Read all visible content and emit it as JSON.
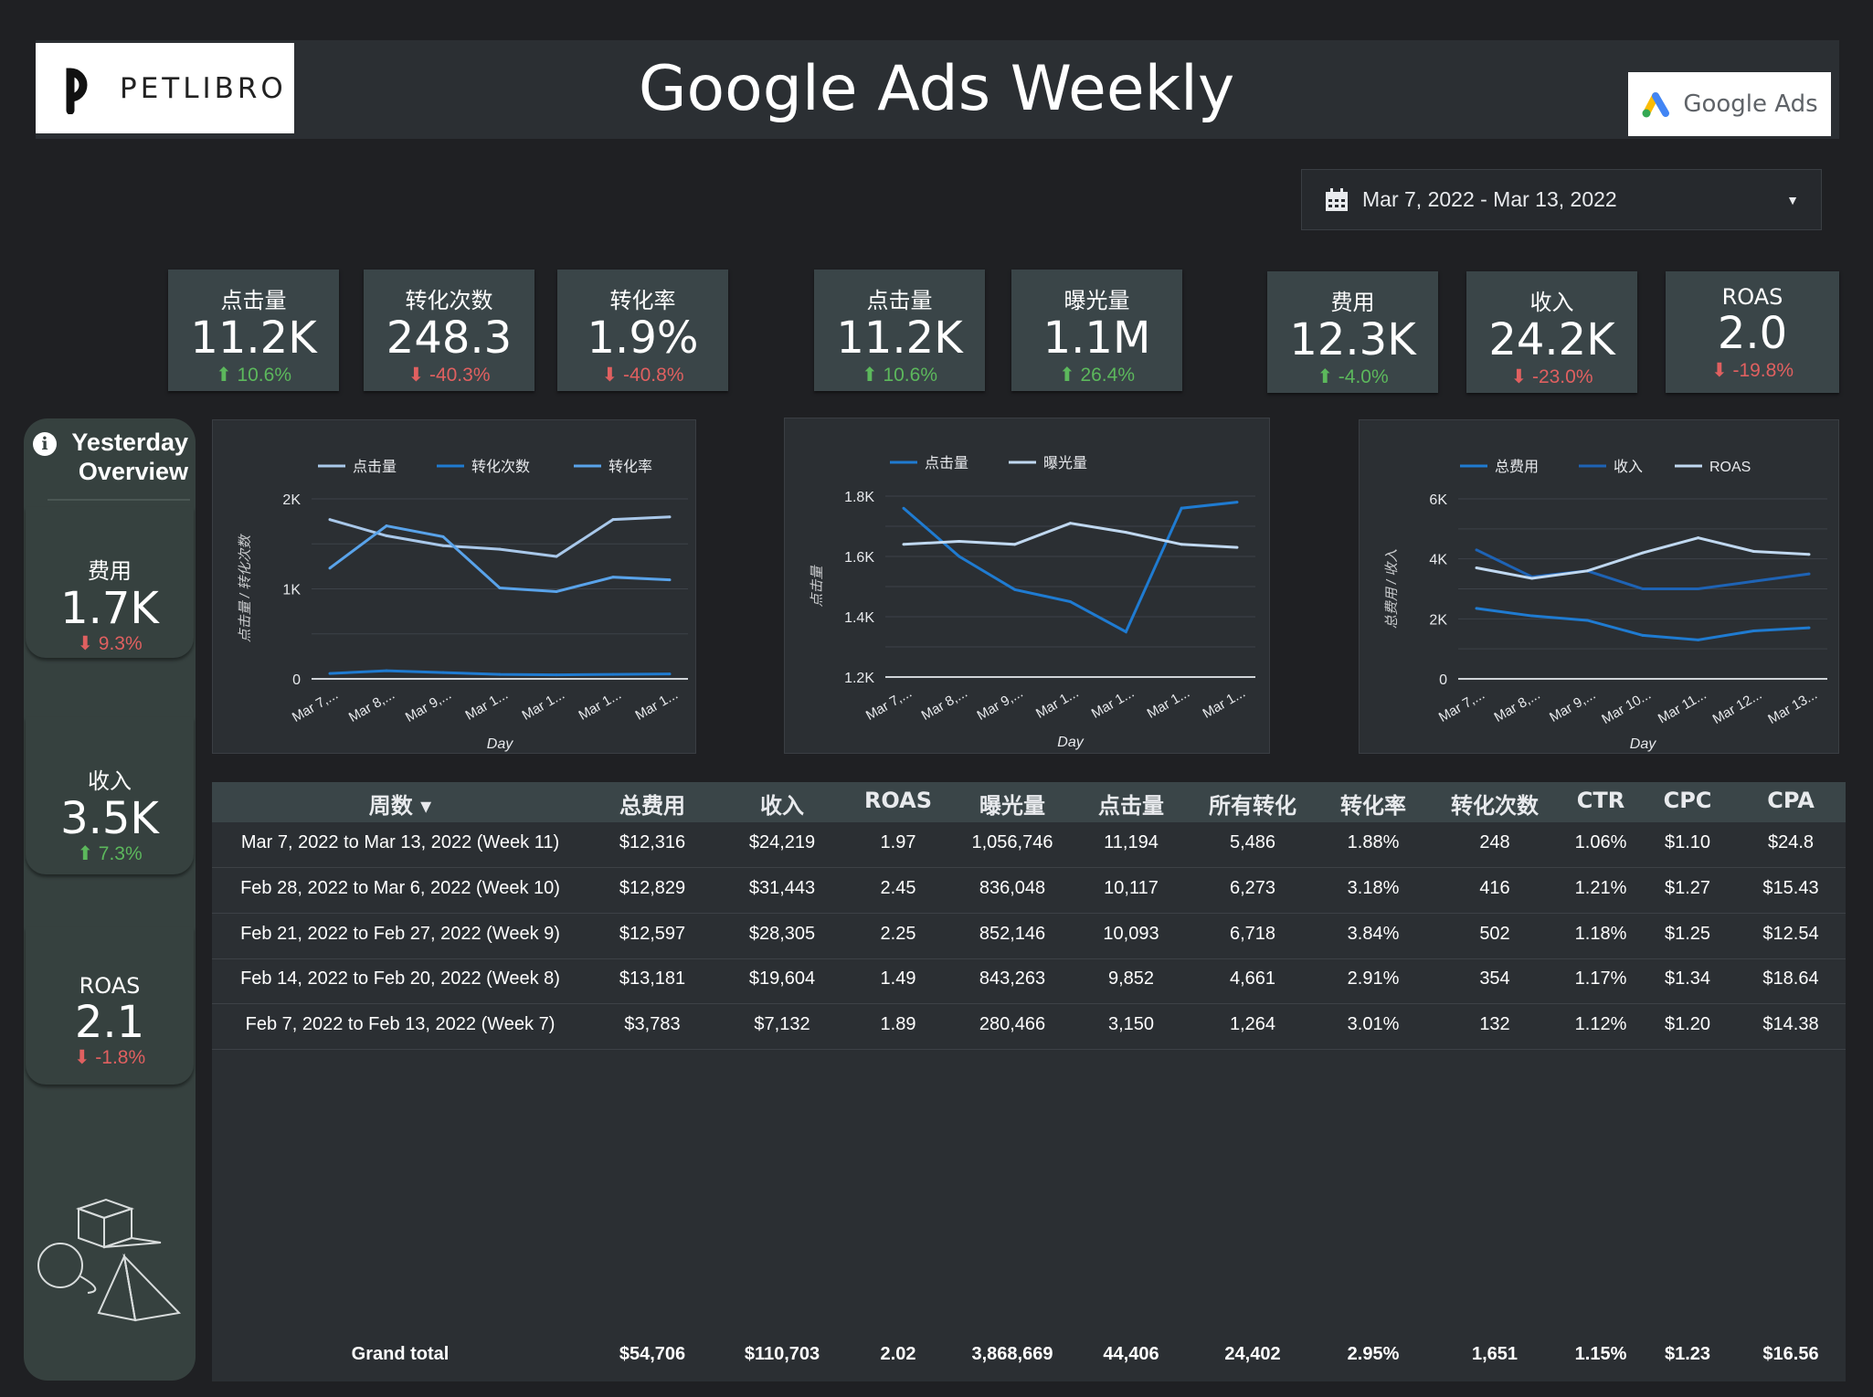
{
  "header": {
    "brand": "PETLIBRO",
    "title": "Google Ads Weekly",
    "gads_label": "Google Ads"
  },
  "date_range": "Mar 7, 2022 - Mar 13, 2022",
  "kpis": [
    {
      "label": "点击量",
      "value": "11.2K",
      "change": "10.6%",
      "dir": "up"
    },
    {
      "label": "转化次数",
      "value": "248.3",
      "change": "-40.3%",
      "dir": "down"
    },
    {
      "label": "转化率",
      "value": "1.9%",
      "change": "-40.8%",
      "dir": "down"
    },
    {
      "label": "点击量",
      "value": "11.2K",
      "change": "10.6%",
      "dir": "up"
    },
    {
      "label": "曝光量",
      "value": "1.1M",
      "change": "26.4%",
      "dir": "up"
    },
    {
      "label": "费用",
      "value": "12.3K",
      "change": "-4.0%",
      "dir": "up"
    },
    {
      "label": "收入",
      "value": "24.2K",
      "change": "-23.0%",
      "dir": "down"
    },
    {
      "label": "ROAS",
      "value": "2.0",
      "change": "-19.8%",
      "dir": "down"
    }
  ],
  "sidebar": {
    "title_line1": "Yesterday",
    "title_line2": "Overview",
    "cards": [
      {
        "label": "费用",
        "value": "1.7K",
        "change": "9.3%",
        "dir": "down"
      },
      {
        "label": "收入",
        "value": "3.5K",
        "change": "7.3%",
        "dir": "up"
      },
      {
        "label": "ROAS",
        "value": "2.1",
        "change": "-1.8%",
        "dir": "down"
      }
    ]
  },
  "chart_data": [
    {
      "type": "line",
      "x": [
        "Mar 7,...",
        "Mar 8,...",
        "Mar 9,...",
        "Mar 1...",
        "Mar 1...",
        "Mar 1...",
        "Mar 1..."
      ],
      "xlabel": "Day",
      "ylabel": "点击量 / 转化次数",
      "ylim": [
        0,
        2000
      ],
      "yticks": [
        "0",
        "1K",
        "2K"
      ],
      "grid": true,
      "legend_position": "top",
      "series": [
        {
          "name": "点击量",
          "color": "#a9c8ea",
          "values": [
            1770,
            1590,
            1480,
            1440,
            1360,
            1770,
            1800
          ]
        },
        {
          "name": "转化次数",
          "color": "#1f7bd1",
          "values": [
            60,
            90,
            70,
            50,
            45,
            50,
            55
          ]
        },
        {
          "name": "转化率",
          "color": "#59a3ea",
          "values": [
            1230,
            1700,
            1580,
            1010,
            970,
            1130,
            1100
          ]
        }
      ]
    },
    {
      "type": "line",
      "x": [
        "Mar 7,...",
        "Mar 8,...",
        "Mar 9,...",
        "Mar 1...",
        "Mar 1...",
        "Mar 1...",
        "Mar 1..."
      ],
      "xlabel": "Day",
      "ylabel": "点击量",
      "ylim": [
        1200,
        1800
      ],
      "yticks": [
        "1.2K",
        "1.4K",
        "1.6K",
        "1.8K"
      ],
      "grid": true,
      "legend_position": "top",
      "series": [
        {
          "name": "点击量",
          "color": "#1f7bd1",
          "values": [
            1760,
            1600,
            1490,
            1450,
            1350,
            1760,
            1780
          ]
        },
        {
          "name": "曝光量",
          "color": "#c0d8f0",
          "values": [
            1640,
            1650,
            1640,
            1710,
            1680,
            1640,
            1630
          ]
        }
      ]
    },
    {
      "type": "line",
      "x": [
        "Mar 7,...",
        "Mar 8,...",
        "Mar 9,...",
        "Mar 10...",
        "Mar 11...",
        "Mar 12...",
        "Mar 13..."
      ],
      "xlabel": "Day",
      "ylabel": "总费用 / 收入",
      "ylim": [
        0,
        6000
      ],
      "yticks": [
        "0",
        "2K",
        "4K",
        "6K"
      ],
      "grid": true,
      "legend_position": "top",
      "series": [
        {
          "name": "总费用",
          "color": "#1f7bd1",
          "values": [
            2350,
            2100,
            1950,
            1450,
            1300,
            1600,
            1700
          ]
        },
        {
          "name": "收入",
          "color": "#1e63b5",
          "values": [
            4300,
            3400,
            3600,
            3000,
            3000,
            3250,
            3500
          ]
        },
        {
          "name": "ROAS",
          "color": "#c0d8f0",
          "values": [
            3700,
            3350,
            3600,
            4200,
            4700,
            4250,
            4150
          ]
        }
      ]
    }
  ],
  "table": {
    "headers": [
      "周数 ▾",
      "总费用",
      "收入",
      "ROAS",
      "曝光量",
      "点击量",
      "所有转化",
      "转化率",
      "转化次数",
      "CTR",
      "CPC",
      "CPA"
    ],
    "rows": [
      [
        "Mar 7, 2022 to Mar 13, 2022 (Week 11)",
        "$12,316",
        "$24,219",
        "1.97",
        "1,056,746",
        "11,194",
        "5,486",
        "1.88%",
        "248",
        "1.06%",
        "$1.10",
        "$24.8"
      ],
      [
        "Feb 28, 2022 to Mar 6, 2022 (Week 10)",
        "$12,829",
        "$31,443",
        "2.45",
        "836,048",
        "10,117",
        "6,273",
        "3.18%",
        "416",
        "1.21%",
        "$1.27",
        "$15.43"
      ],
      [
        "Feb 21, 2022 to Feb 27, 2022 (Week 9)",
        "$12,597",
        "$28,305",
        "2.25",
        "852,146",
        "10,093",
        "6,718",
        "3.84%",
        "502",
        "1.18%",
        "$1.25",
        "$12.54"
      ],
      [
        "Feb 14, 2022 to Feb 20, 2022 (Week 8)",
        "$13,181",
        "$19,604",
        "1.49",
        "843,263",
        "9,852",
        "4,661",
        "2.91%",
        "354",
        "1.17%",
        "$1.34",
        "$18.64"
      ],
      [
        "Feb 7, 2022 to Feb 13, 2022 (Week 7)",
        "$3,783",
        "$7,132",
        "1.89",
        "280,466",
        "3,150",
        "1,264",
        "3.01%",
        "132",
        "1.12%",
        "$1.20",
        "$14.38"
      ]
    ],
    "total": [
      "Grand total",
      "$54,706",
      "$110,703",
      "2.02",
      "3,868,669",
      "44,406",
      "24,402",
      "2.95%",
      "1,651",
      "1.15%",
      "$1.23",
      "$16.56"
    ]
  }
}
